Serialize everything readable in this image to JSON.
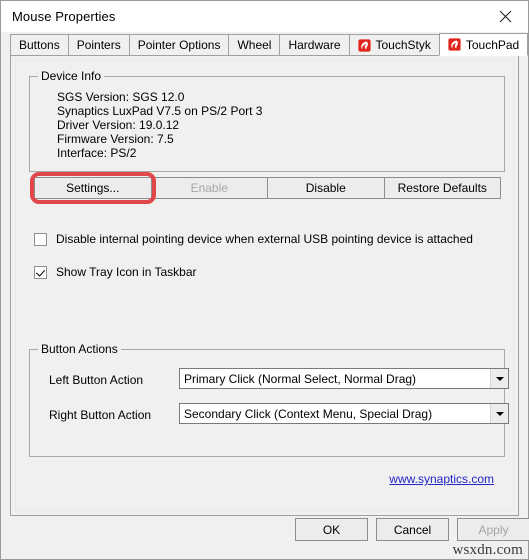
{
  "window": {
    "title": "Mouse Properties",
    "close_icon": "close-icon"
  },
  "tabs": [
    {
      "label": "Buttons",
      "icon": null,
      "active": false
    },
    {
      "label": "Pointers",
      "icon": null,
      "active": false
    },
    {
      "label": "Pointer Options",
      "icon": null,
      "active": false
    },
    {
      "label": "Wheel",
      "icon": null,
      "active": false
    },
    {
      "label": "Hardware",
      "icon": null,
      "active": false
    },
    {
      "label": "TouchStyk",
      "icon": "synaptics-icon",
      "active": false
    },
    {
      "label": "TouchPad",
      "icon": "synaptics-icon",
      "active": true
    }
  ],
  "device_info": {
    "legend": "Device Info",
    "lines": [
      "SGS Version: SGS 12.0",
      "Synaptics LuxPad V7.5 on PS/2 Port 3",
      "Driver Version: 19.0.12",
      "Firmware Version: 7.5",
      "Interface: PS/2"
    ]
  },
  "action_buttons": [
    {
      "label": "Settings...",
      "disabled": false,
      "highlighted": true
    },
    {
      "label": "Enable",
      "disabled": true,
      "highlighted": false
    },
    {
      "label": "Disable",
      "disabled": false,
      "highlighted": false
    },
    {
      "label": "Restore Defaults",
      "disabled": false,
      "highlighted": false
    }
  ],
  "checkboxes": [
    {
      "label": "Disable internal pointing device when external USB pointing device is attached",
      "checked": false
    },
    {
      "label": "Show Tray Icon in Taskbar",
      "checked": true
    }
  ],
  "button_actions": {
    "legend": "Button Actions",
    "left": {
      "label": "Left Button Action",
      "value": "Primary Click (Normal Select, Normal Drag)"
    },
    "right": {
      "label": "Right Button Action",
      "value": "Secondary Click (Context Menu, Special Drag)"
    }
  },
  "link": {
    "text": "www.synaptics.com"
  },
  "footer": {
    "ok": "OK",
    "cancel": "Cancel",
    "apply": "Apply",
    "apply_disabled": true
  },
  "watermark": "wsxdn.com",
  "colors": {
    "highlight_red": "#e0464a",
    "brand_red": "#e2231a",
    "link_blue": "#2424c8",
    "dialog_face": "#f0f0f0"
  }
}
